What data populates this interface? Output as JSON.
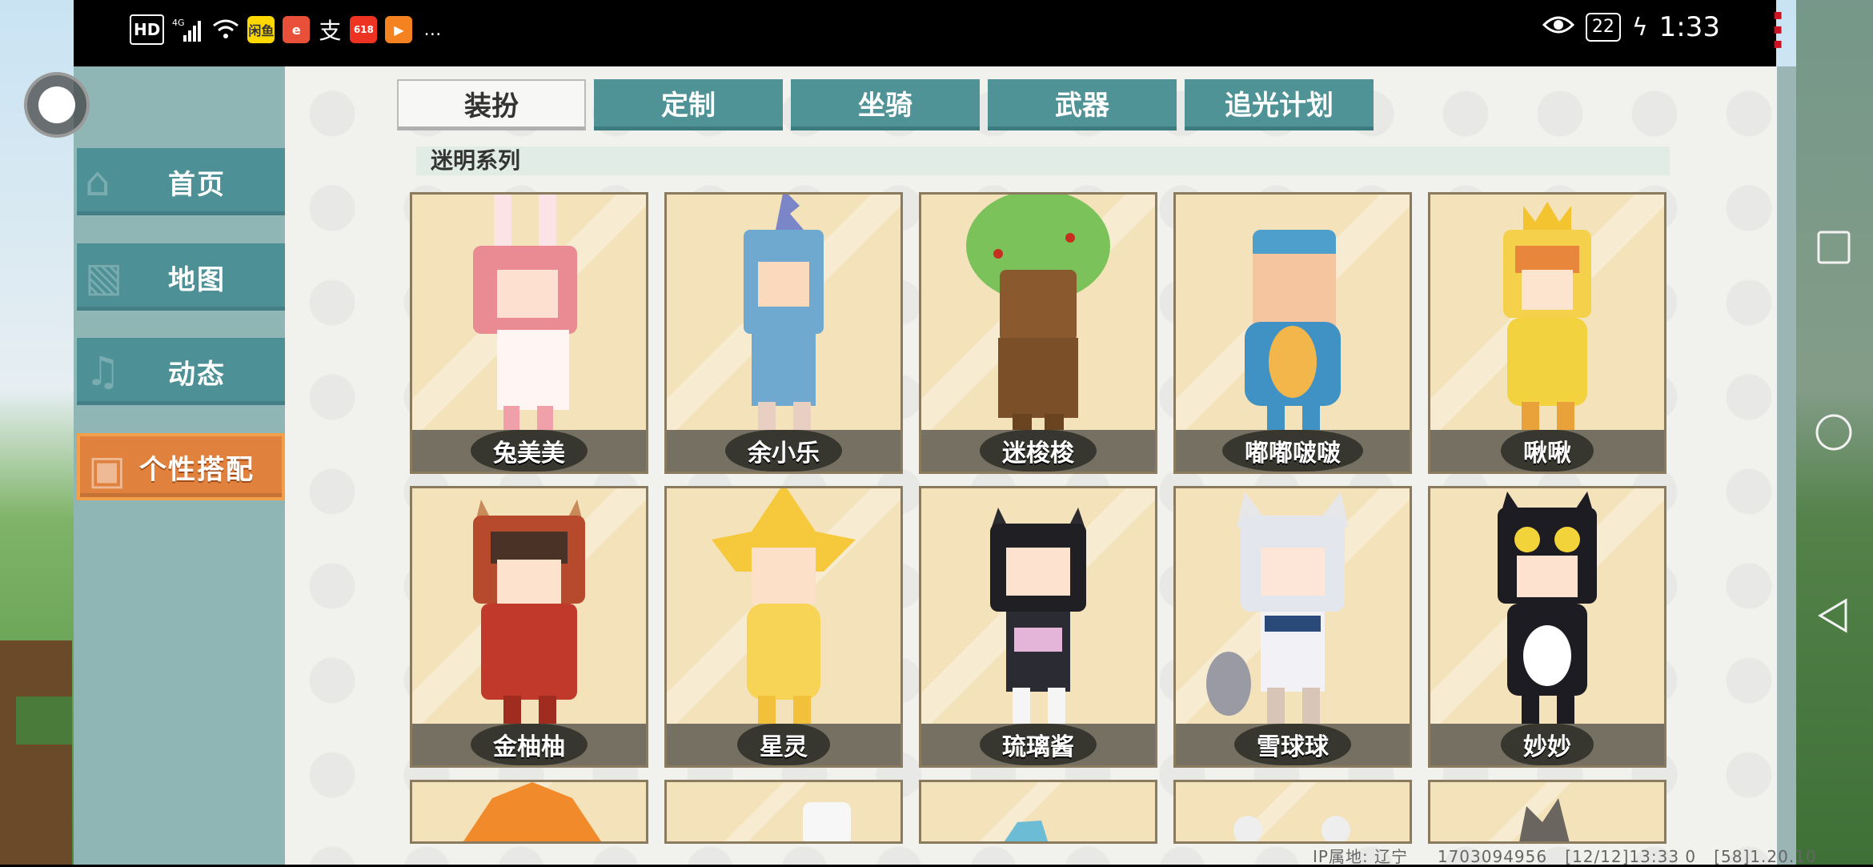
{
  "status_bar": {
    "left_items": [
      "HD",
      "4G",
      "闲鱼",
      "支",
      "…"
    ],
    "time": "1:33",
    "battery": "22"
  },
  "nav": {
    "items": [
      {
        "label": "首页",
        "icon": "home-icon"
      },
      {
        "label": "地图",
        "icon": "map-icon"
      },
      {
        "label": "动态",
        "icon": "bell-icon"
      },
      {
        "label": "个性搭配",
        "icon": "outfit-icon",
        "active": true
      }
    ]
  },
  "tabs": [
    {
      "label": "装扮",
      "active": true
    },
    {
      "label": "定制"
    },
    {
      "label": "坐骑"
    },
    {
      "label": "武器"
    },
    {
      "label": "追光计划"
    }
  ],
  "section_title": "迷明系列",
  "cards": [
    {
      "name": "兔美美"
    },
    {
      "name": "余小乐"
    },
    {
      "name": "迷梭梭"
    },
    {
      "name": "嘟嘟啵啵"
    },
    {
      "name": "啾啾"
    },
    {
      "name": "金柚柚"
    },
    {
      "name": "星灵"
    },
    {
      "name": "琉璃酱"
    },
    {
      "name": "雪球球"
    },
    {
      "name": "妙妙"
    }
  ],
  "footer": {
    "ip": "IP属地: 辽宁",
    "uid": "1703094956",
    "time": "[12/12]13:33 0",
    "version": "[58]1.20.10"
  },
  "colors": {
    "tab_bg": "#4f9396",
    "nav_bg": "#4d9197",
    "nav_active": "#e0823e",
    "card_bg": "#f3e2ba"
  }
}
